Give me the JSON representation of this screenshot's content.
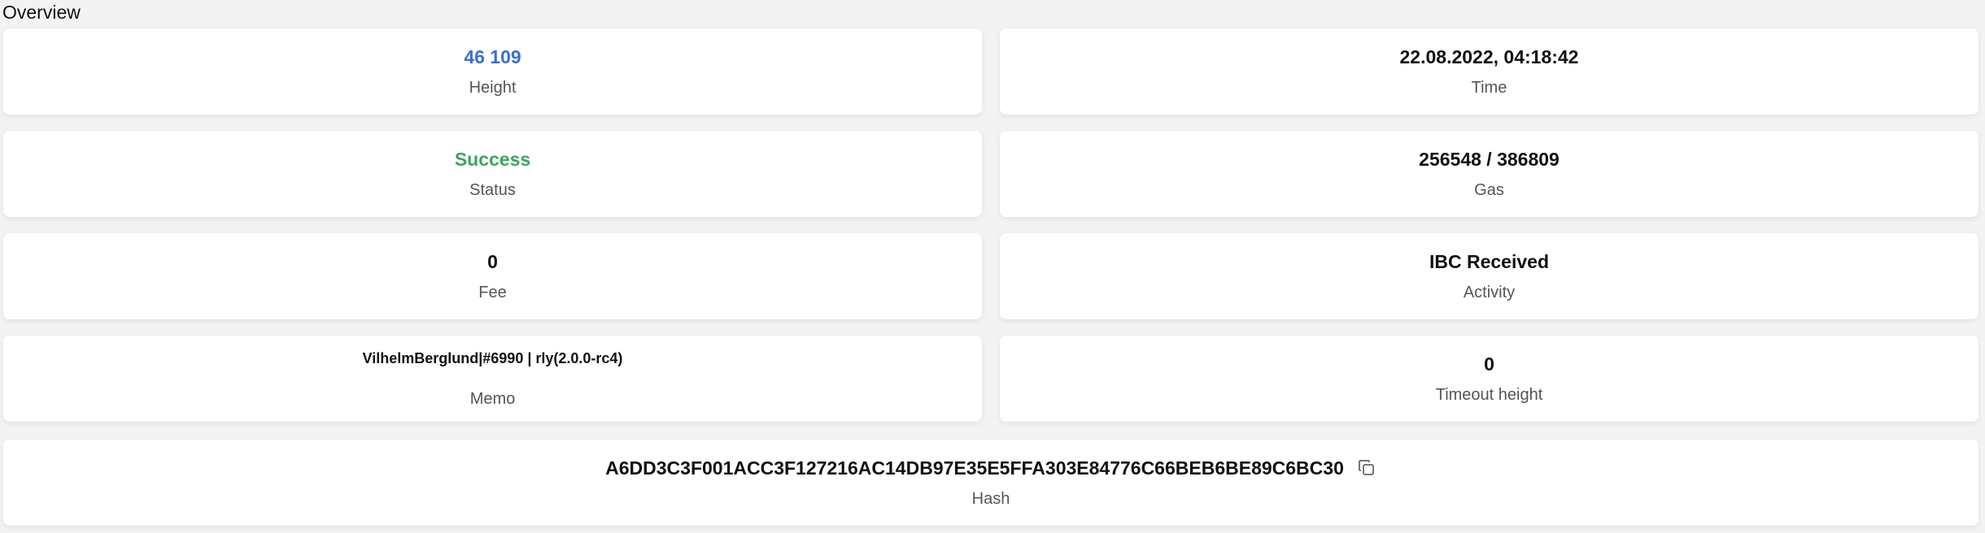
{
  "section": {
    "title": "Overview"
  },
  "cards": [
    {
      "value": "46 109",
      "label": "Height"
    },
    {
      "value": "22.08.2022, 04:18:42",
      "label": "Time"
    },
    {
      "value": "Success",
      "label": "Status"
    },
    {
      "value": "256548 / 386809",
      "label": "Gas"
    },
    {
      "value": "0",
      "label": "Fee"
    },
    {
      "value": "IBC Received",
      "label": "Activity"
    },
    {
      "value": "VilhelmBerglund|#6990 | rly(2.0.0-rc4)",
      "label": "Memo"
    },
    {
      "value": "0",
      "label": "Timeout height"
    }
  ],
  "hash": {
    "value": "A6DD3C3F001ACC3F127216AC14DB97E35E5FFA303E84776C66BEB6BE89C6BC30",
    "label": "Hash",
    "copy_icon": "copy-icon"
  },
  "colors": {
    "height_value": "#3b6fd6",
    "status_success": "#3aa65a",
    "background": "#f3f3f3",
    "card": "#ffffff"
  }
}
